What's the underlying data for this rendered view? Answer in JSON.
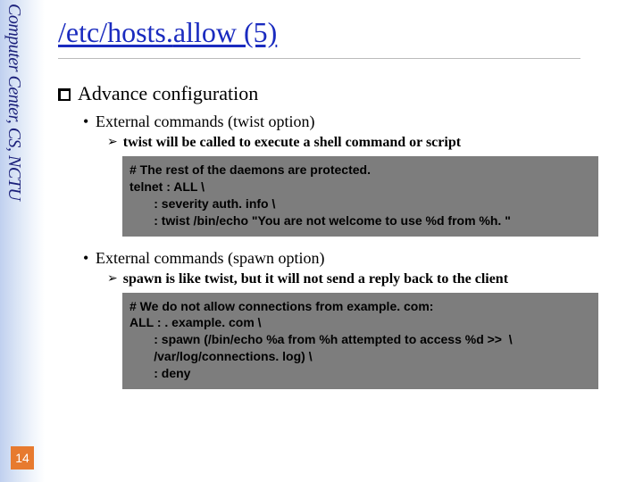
{
  "sidebar": {
    "affiliation": "Computer Center, CS, NCTU",
    "page_number": "14"
  },
  "title": {
    "underlined": "/etc/hosts.",
    "rest": "allow (5)"
  },
  "section": {
    "heading": "Advance configuration",
    "item1": {
      "label": "External commands (twist option)",
      "note": "twist will be called to execute a shell command or script",
      "code": "# The rest of the daemons are protected.\ntelnet : ALL \\\n       : severity auth. info \\\n       : twist /bin/echo \"You are not welcome to use %d from %h. \""
    },
    "item2": {
      "label": "External commands (spawn option)",
      "note": "spawn is like twist, but it will not send a reply back to the client",
      "code": "# We do not allow connections from example. com:\nALL : . example. com \\\n       : spawn (/bin/echo %a from %h attempted to access %d >>  \\\n       /var/log/connections. log) \\\n       : deny"
    }
  }
}
